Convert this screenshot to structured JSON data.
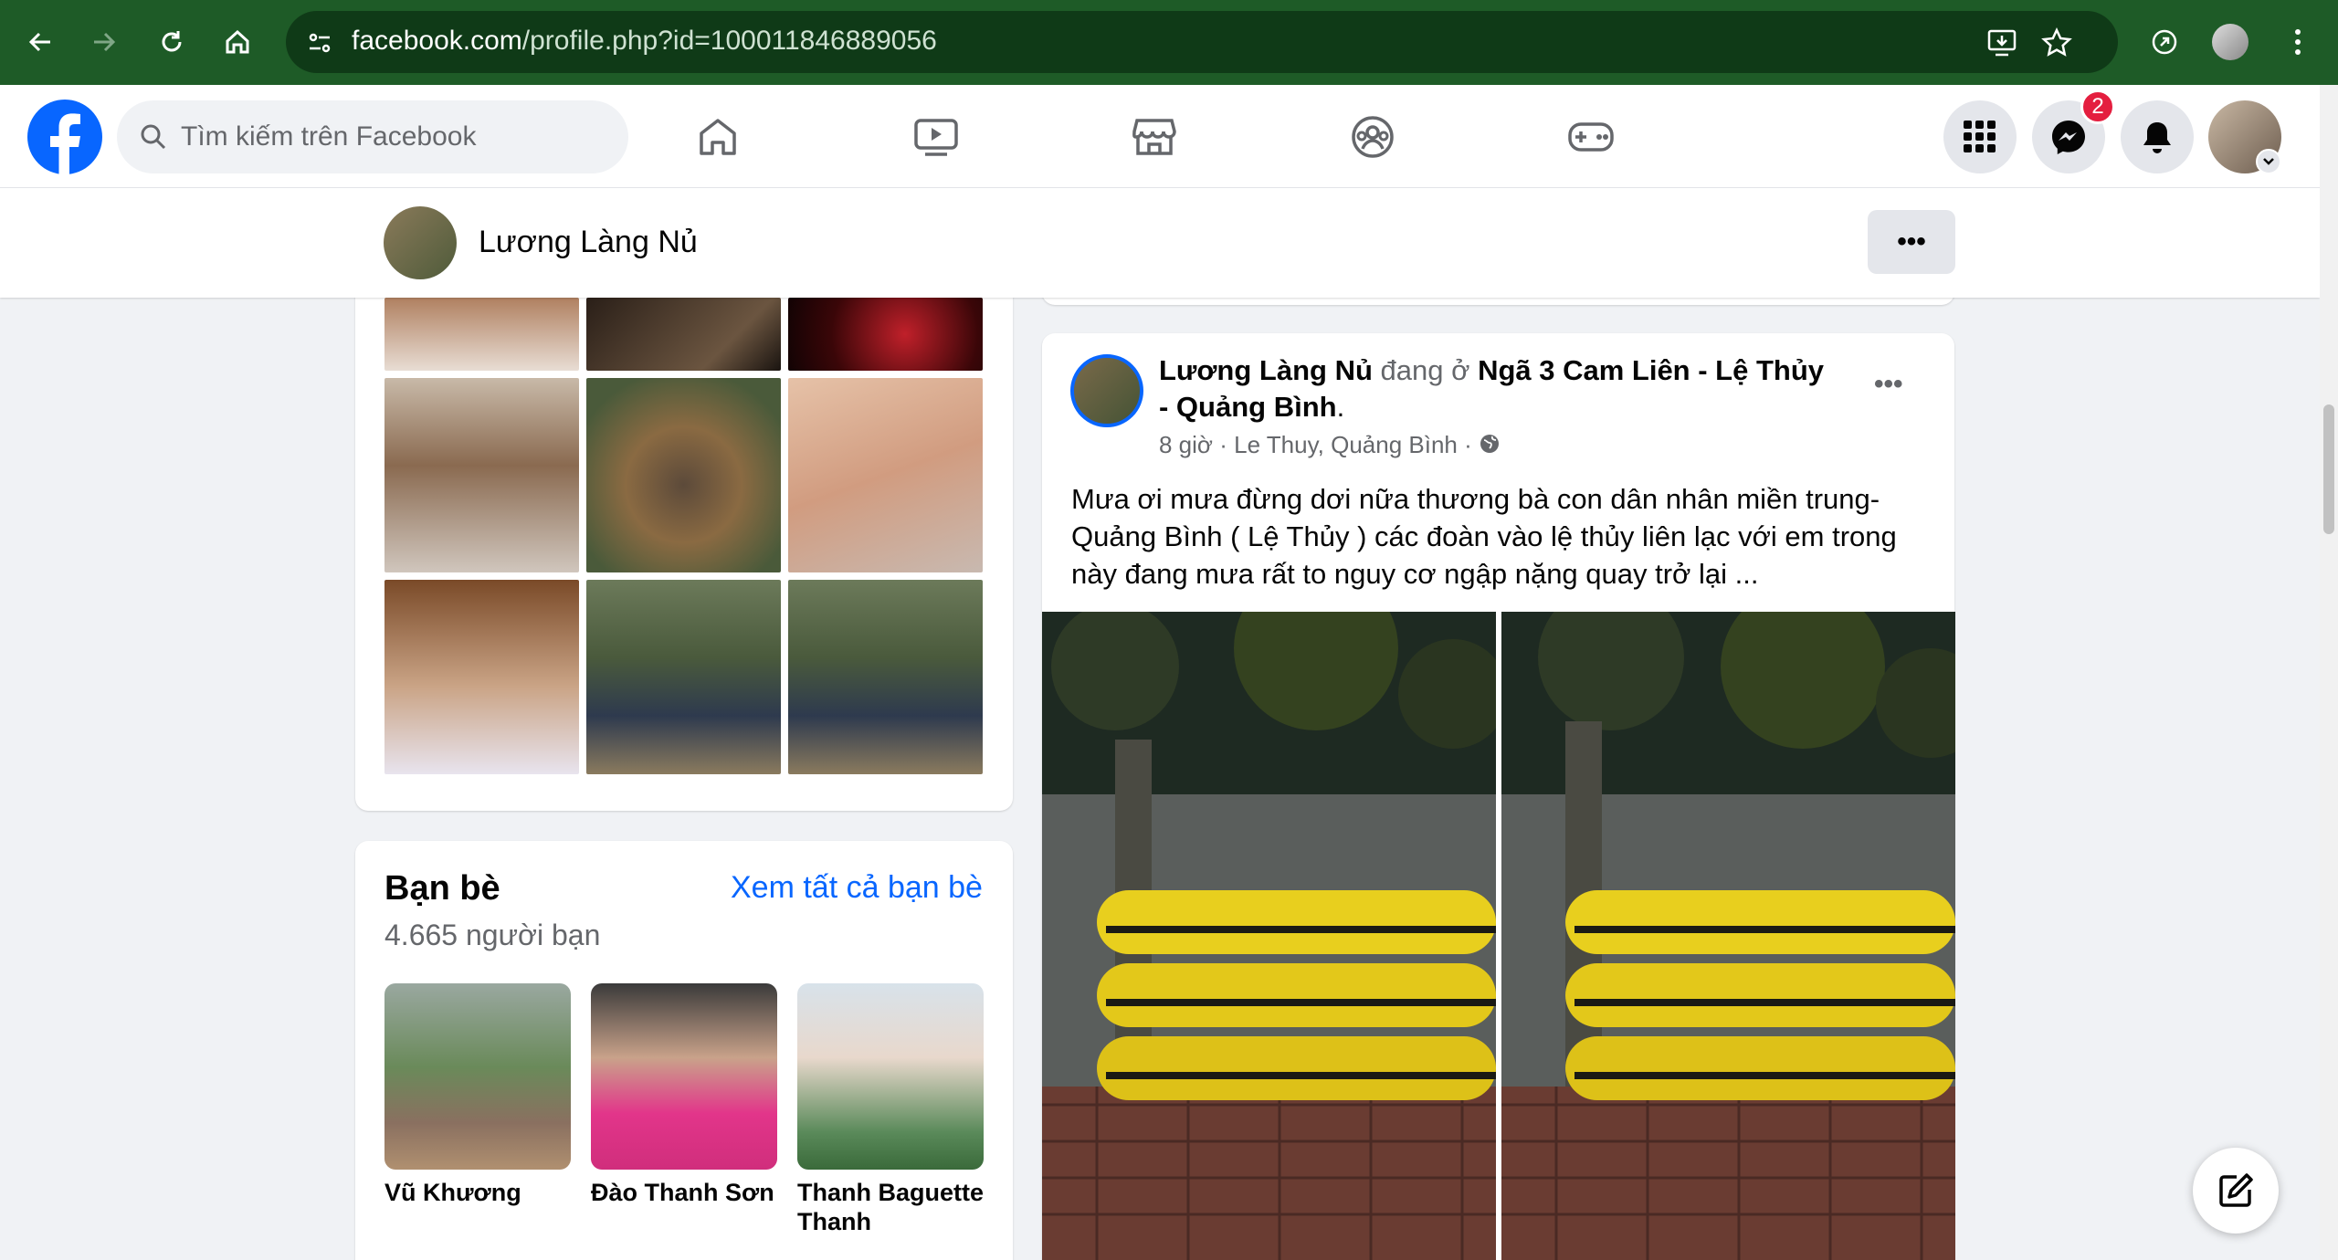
{
  "browser": {
    "url_host": "facebook.com",
    "url_path": "/profile.php?id=100011846889056"
  },
  "fb": {
    "search_placeholder": "Tìm kiếm trên Facebook",
    "messenger_badge": "2",
    "colors": {
      "brand": "#0866ff",
      "chrome": "#1e5b27",
      "badge": "#e41e3f"
    }
  },
  "profile": {
    "name": "Lương Làng Nủ",
    "more_label": "•••"
  },
  "friends": {
    "title": "Bạn bè",
    "see_all": "Xem tất cả bạn bè",
    "count": "4.665 người bạn",
    "items": [
      {
        "name": "Vũ Khương"
      },
      {
        "name": "Đào Thanh Sơn"
      },
      {
        "name": "Thanh Baguette Thanh"
      }
    ]
  },
  "post": {
    "author": "Lương Làng Nủ",
    "at_text": "đang ở",
    "place": "Ngã 3 Cam Liên - Lệ Thủy - Quảng Bình",
    "end_punct": ".",
    "time": "8 giờ",
    "location": "Le Thuy, Quảng Bình",
    "sep": "·",
    "more_label": "•••",
    "text": "Mưa ơi mưa đừng dơi nữa thương bà con dân nhân miền trung- Quảng Bình ( Lệ Thủy ) các đoàn vào lệ thủy liên lạc với em trong này đang mưa rất to nguy cơ ngập nặng quay trở lại ..."
  }
}
